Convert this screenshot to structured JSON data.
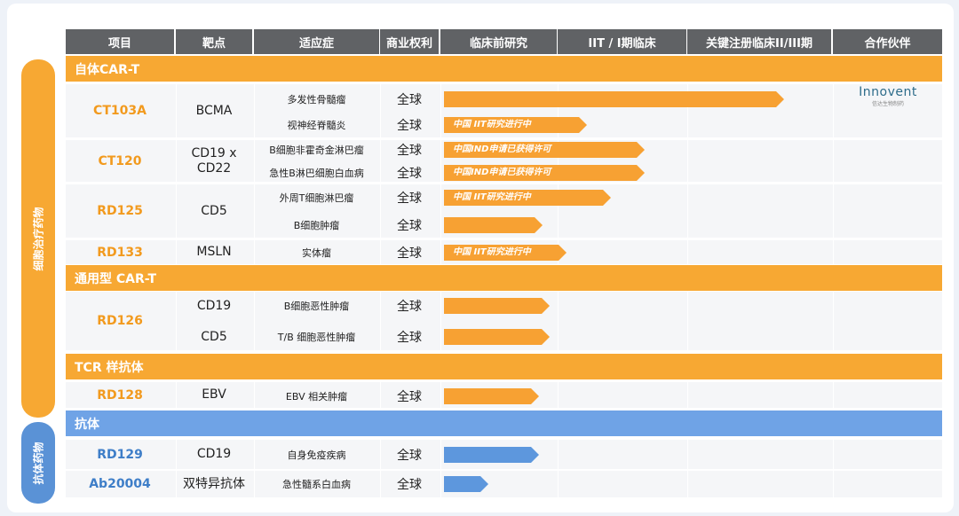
{
  "headers": [
    "项目",
    "靶点",
    "适应症",
    "商业权利",
    "临床前研究",
    "IIT / I期临床",
    "关键注册临床II/III期",
    "合作伙伴"
  ],
  "sidebar": {
    "cell_therapy": "细胞治疗药物",
    "antibody": "抗体药物"
  },
  "sections": [
    {
      "label": "自体CAR-T",
      "color": "orange"
    },
    {
      "label": "通用型 CAR-T",
      "color": "orange"
    },
    {
      "label": "TCR 样抗体",
      "color": "orange"
    },
    {
      "label": "抗体",
      "color": "blue"
    }
  ],
  "programs": [
    {
      "code": "CT103A",
      "target": "BCMA",
      "indications": [
        {
          "name": "多发性骨髓瘤",
          "rights": "全球",
          "progress": 1.0,
          "bar_label": ""
        },
        {
          "name": "视神经脊髓炎",
          "rights": "全球",
          "progress": 0.42,
          "bar_label": "中国 IIT研究进行中"
        }
      ],
      "partner": {
        "name": "Innovent",
        "sub": "信达生物制药"
      }
    },
    {
      "code": "CT120",
      "target": "CD19 x CD22",
      "indications": [
        {
          "name": "B细胞非霍奇金淋巴瘤",
          "rights": "全球",
          "progress": 0.59,
          "bar_label": "中国IND申请已获得许可"
        },
        {
          "name": "急性B淋巴细胞白血病",
          "rights": "全球",
          "progress": 0.59,
          "bar_label": "中国IND申请已获得许可"
        }
      ]
    },
    {
      "code": "RD125",
      "target": "CD5",
      "indications": [
        {
          "name": "外周T细胞淋巴瘤",
          "rights": "全球",
          "progress": 0.49,
          "bar_label": "中国 IIT研究进行中"
        },
        {
          "name": "B细胞肿瘤",
          "rights": "全球",
          "progress": 0.29,
          "bar_label": ""
        }
      ]
    },
    {
      "code": "RD133",
      "target": "MSLN",
      "indications": [
        {
          "name": "实体瘤",
          "rights": "全球",
          "progress": 0.36,
          "bar_label": "中国 IIT研究进行中"
        }
      ]
    },
    {
      "code": "RD126",
      "target": "",
      "indications": [
        {
          "name": "B细胞恶性肿瘤",
          "target": "CD19",
          "rights": "全球",
          "progress": 0.31,
          "bar_label": ""
        },
        {
          "name": "T/B 细胞恶性肿瘤",
          "target": "CD5",
          "rights": "全球",
          "progress": 0.31,
          "bar_label": ""
        }
      ]
    },
    {
      "code": "RD128",
      "target": "EBV",
      "indications": [
        {
          "name": "EBV 相关肿瘤",
          "rights": "全球",
          "progress": 0.28,
          "bar_label": ""
        }
      ]
    },
    {
      "code": "RD129",
      "target": "CD19",
      "indications": [
        {
          "name": "自身免疫疾病",
          "rights": "全球",
          "progress": 0.28,
          "bar_label": ""
        }
      ]
    },
    {
      "code": "Ab20004",
      "target": "双特异抗体",
      "indications": [
        {
          "name": "急性髓系白血病",
          "rights": "全球",
          "progress": 0.13,
          "bar_label": ""
        }
      ]
    }
  ],
  "colors": {
    "orange": "#f7a833",
    "blue": "#6fa3e6",
    "header": "#606265"
  }
}
